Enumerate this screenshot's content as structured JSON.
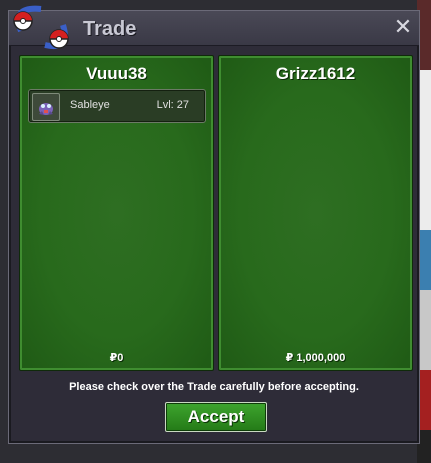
{
  "window": {
    "title": "Trade",
    "close_glyph": "✕"
  },
  "left_panel": {
    "player": "Vuuu38",
    "items": [
      {
        "name": "Sableye",
        "level": "Lvl: 27",
        "icon": "sableye-sprite-icon"
      }
    ],
    "money": "₽0"
  },
  "right_panel": {
    "player": "Grizz1612",
    "items": [],
    "money": "₽ 1,000,000"
  },
  "notice": "Please check over the Trade carefully before accepting.",
  "accept_label": "Accept",
  "colors": {
    "panel_green": "#2a6b1e",
    "window_bg": "#2e2c38",
    "accept_green": "#2f8f22"
  }
}
